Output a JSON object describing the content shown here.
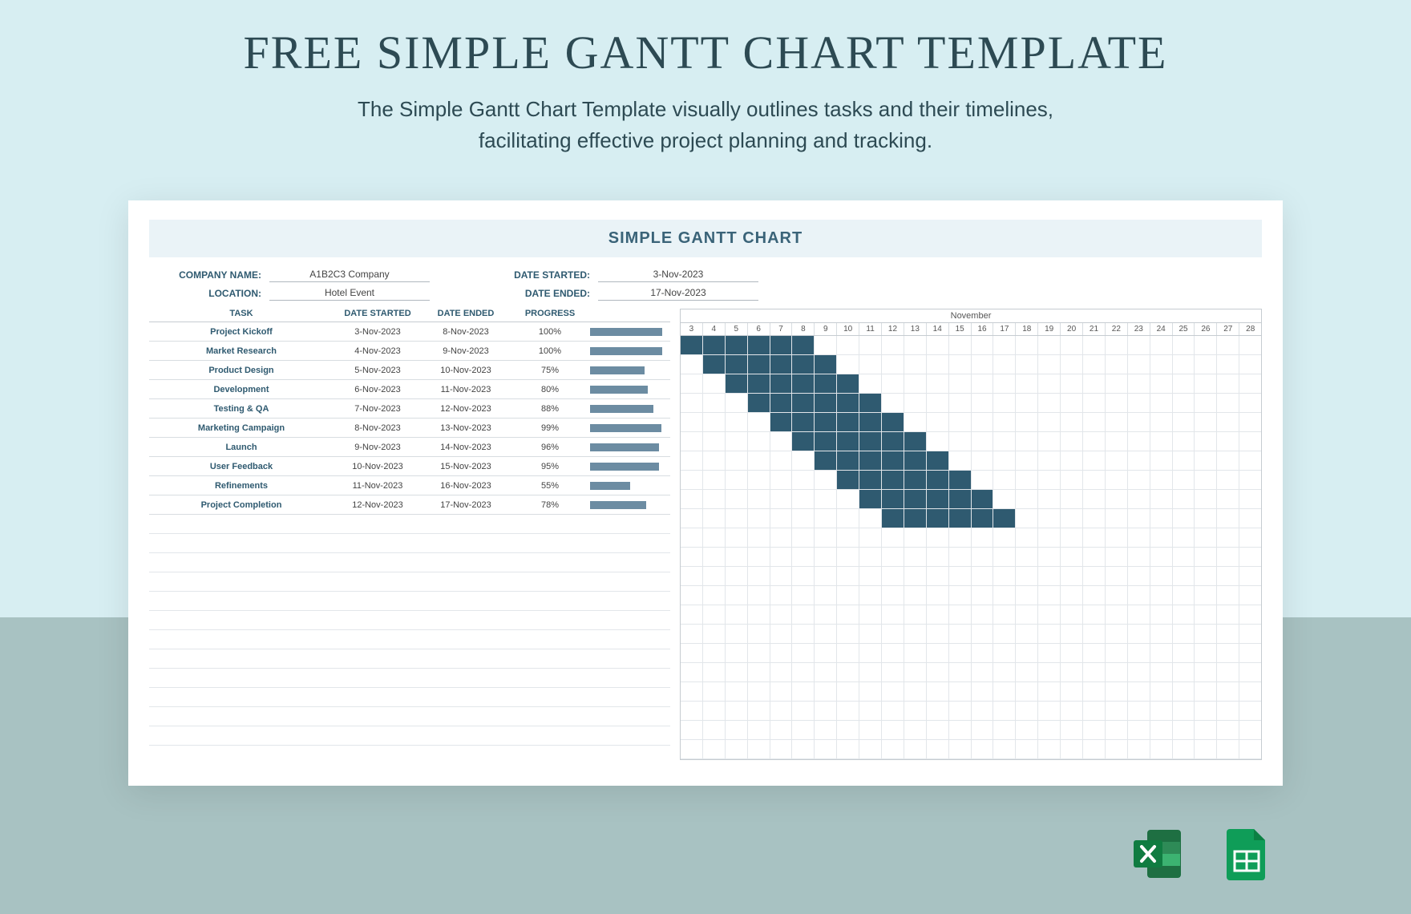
{
  "page": {
    "title": "FREE SIMPLE GANTT CHART TEMPLATE",
    "subtitle_l1": "The Simple Gantt Chart Template visually outlines tasks and their timelines,",
    "subtitle_l2": "facilitating effective project planning and tracking."
  },
  "chart": {
    "title": "SIMPLE GANTT CHART",
    "meta_left": [
      {
        "label": "COMPANY NAME:",
        "value": "A1B2C3 Company"
      },
      {
        "label": "LOCATION:",
        "value": "Hotel Event"
      }
    ],
    "meta_right": [
      {
        "label": "DATE STARTED:",
        "value": "3-Nov-2023"
      },
      {
        "label": "DATE ENDED:",
        "value": "17-Nov-2023"
      }
    ],
    "columns": {
      "task": "TASK",
      "start": "DATE STARTED",
      "end": "DATE ENDED",
      "progress": "PROGRESS"
    },
    "timeline": {
      "month": "November",
      "days": [
        3,
        4,
        5,
        6,
        7,
        8,
        9,
        10,
        11,
        12,
        13,
        14,
        15,
        16,
        17,
        18,
        19,
        20,
        21,
        22,
        23,
        24,
        25,
        26,
        27,
        28
      ]
    },
    "empty_rows": 12
  },
  "icons": {
    "excel_name": "excel-icon",
    "sheets_name": "google-sheets-icon"
  },
  "chart_data": {
    "type": "gantt",
    "title": "SIMPLE GANTT CHART",
    "xlabel": "November",
    "x_range": [
      3,
      28
    ],
    "tasks": [
      {
        "name": "Project Kickoff",
        "start": "3-Nov-2023",
        "end": "8-Nov-2023",
        "start_day": 3,
        "end_day": 8,
        "progress": 100,
        "progress_label": "100%"
      },
      {
        "name": "Market Research",
        "start": "4-Nov-2023",
        "end": "9-Nov-2023",
        "start_day": 4,
        "end_day": 9,
        "progress": 100,
        "progress_label": "100%"
      },
      {
        "name": "Product Design",
        "start": "5-Nov-2023",
        "end": "10-Nov-2023",
        "start_day": 5,
        "end_day": 10,
        "progress": 75,
        "progress_label": "75%"
      },
      {
        "name": "Development",
        "start": "6-Nov-2023",
        "end": "11-Nov-2023",
        "start_day": 6,
        "end_day": 11,
        "progress": 80,
        "progress_label": "80%"
      },
      {
        "name": "Testing & QA",
        "start": "7-Nov-2023",
        "end": "12-Nov-2023",
        "start_day": 7,
        "end_day": 12,
        "progress": 88,
        "progress_label": "88%"
      },
      {
        "name": "Marketing Campaign",
        "start": "8-Nov-2023",
        "end": "13-Nov-2023",
        "start_day": 8,
        "end_day": 13,
        "progress": 99,
        "progress_label": "99%"
      },
      {
        "name": "Launch",
        "start": "9-Nov-2023",
        "end": "14-Nov-2023",
        "start_day": 9,
        "end_day": 14,
        "progress": 96,
        "progress_label": "96%"
      },
      {
        "name": "User Feedback",
        "start": "10-Nov-2023",
        "end": "15-Nov-2023",
        "start_day": 10,
        "end_day": 15,
        "progress": 95,
        "progress_label": "95%"
      },
      {
        "name": "Refinements",
        "start": "11-Nov-2023",
        "end": "16-Nov-2023",
        "start_day": 11,
        "end_day": 16,
        "progress": 55,
        "progress_label": "55%"
      },
      {
        "name": "Project Completion",
        "start": "12-Nov-2023",
        "end": "17-Nov-2023",
        "start_day": 12,
        "end_day": 17,
        "progress": 78,
        "progress_label": "78%"
      }
    ]
  }
}
